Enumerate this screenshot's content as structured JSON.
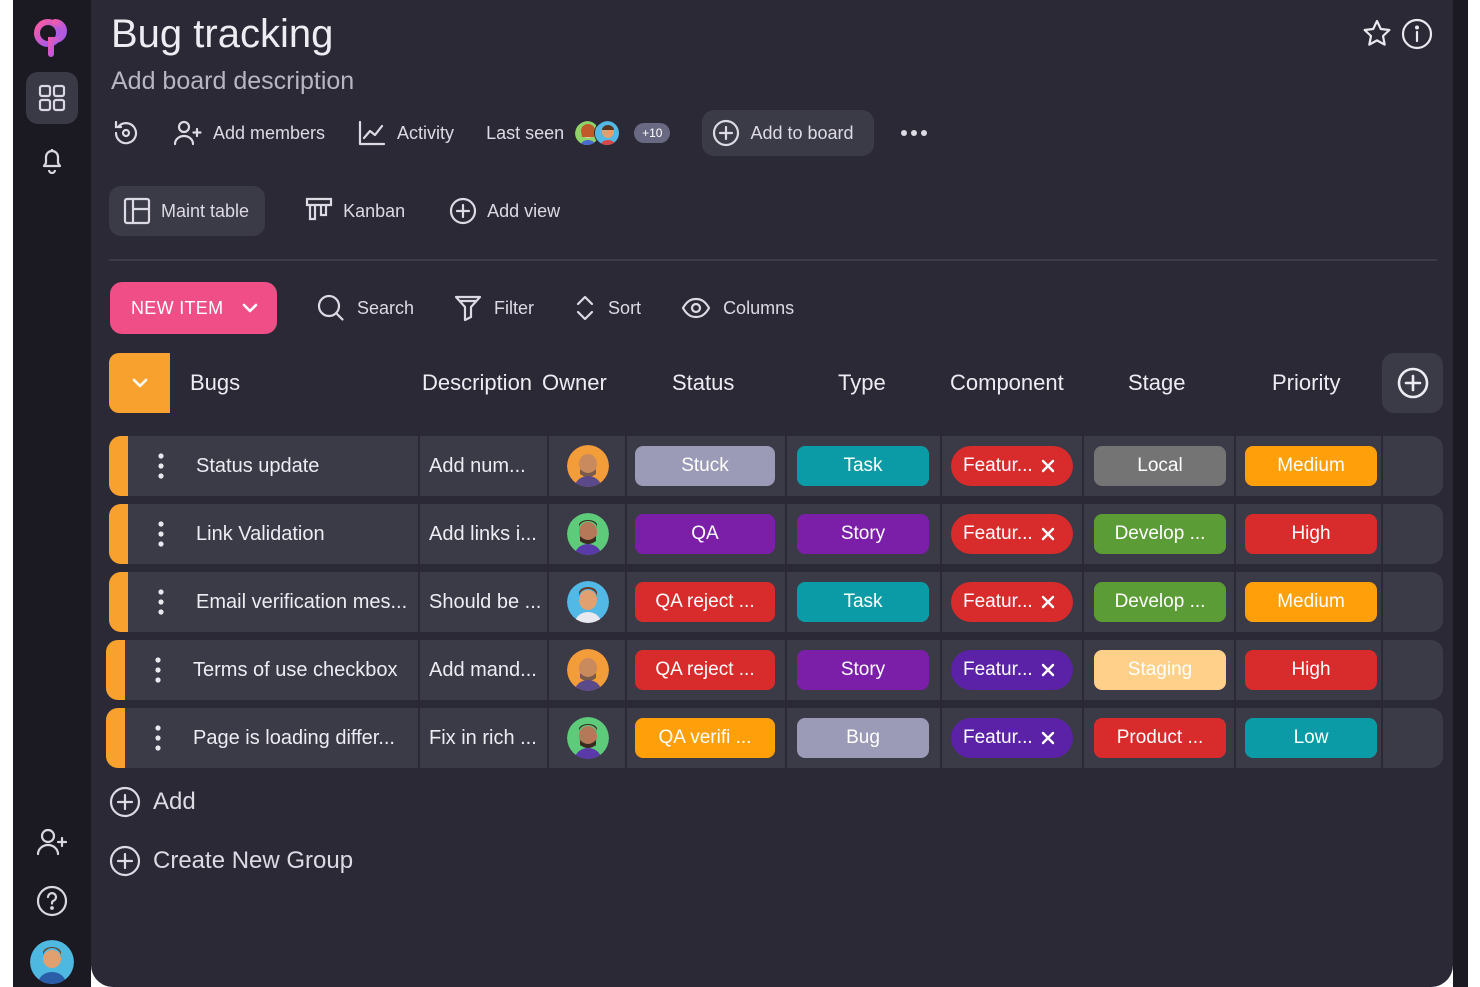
{
  "board": {
    "title": "Bug tracking",
    "description_placeholder": "Add board description"
  },
  "toolbar": {
    "add_members": "Add members",
    "activity": "Activity",
    "last_seen": "Last seen",
    "last_seen_extra": "+10",
    "add_to_board": "Add to board"
  },
  "views": {
    "main_table": "Maint table",
    "kanban": "Kanban",
    "add_view": "Add view"
  },
  "actions": {
    "new_item": "NEW ITEM",
    "search": "Search",
    "filter": "Filter",
    "sort": "Sort",
    "columns": "Columns"
  },
  "table": {
    "group_name": "Bugs",
    "columns": [
      "Description",
      "Owner",
      "Status",
      "Type",
      "Component",
      "Stage",
      "Priority"
    ],
    "rows": [
      {
        "name": "Status update",
        "description": "Add num...",
        "status": "Stuck",
        "type": "Task",
        "component": "Featur...",
        "stage": "Local",
        "priority": "Medium"
      },
      {
        "name": "Link Validation",
        "description": "Add links i...",
        "status": "QA",
        "type": "Story",
        "component": "Featur...",
        "stage": "Develop ...",
        "priority": "High"
      },
      {
        "name": "Email verification mes...",
        "description": "Should be ...",
        "status": "QA reject ...",
        "type": "Task",
        "component": "Featur...",
        "stage": "Develop ...",
        "priority": "Medium"
      },
      {
        "name": "Terms of use checkbox",
        "description": "Add mand...",
        "status": "QA reject ...",
        "type": "Story",
        "component": "Featur...",
        "stage": "Staging",
        "priority": "High"
      },
      {
        "name": "Page is loading differ...",
        "description": "Fix in rich ...",
        "status": "QA verifi ...",
        "type": "Bug",
        "component": "Featur...",
        "stage": "Product ...",
        "priority": "Low"
      }
    ]
  },
  "footer": {
    "add": "Add",
    "create_group": "Create New Group"
  },
  "colors": {
    "accent": "#ef4f86",
    "group": "#f9a12e",
    "status_stuck": "#9b9ab7",
    "status_qa": "#7b1fa8",
    "status_qa_reject": "#d82b2b",
    "status_qa_verify": "#ff9f0a",
    "type_task": "#0b9ba6",
    "type_story": "#7b1fa8",
    "type_bug": "#9b9ab7",
    "component_red": "#d82b2b",
    "component_purple": "#5b22a8",
    "stage_local": "#747474",
    "stage_develop": "#5c9c36",
    "stage_staging": "#ffd08a",
    "stage_product": "#d82b2b",
    "priority_medium": "#ff9f0a",
    "priority_high": "#d82b2b",
    "priority_low": "#0b9ba6"
  }
}
